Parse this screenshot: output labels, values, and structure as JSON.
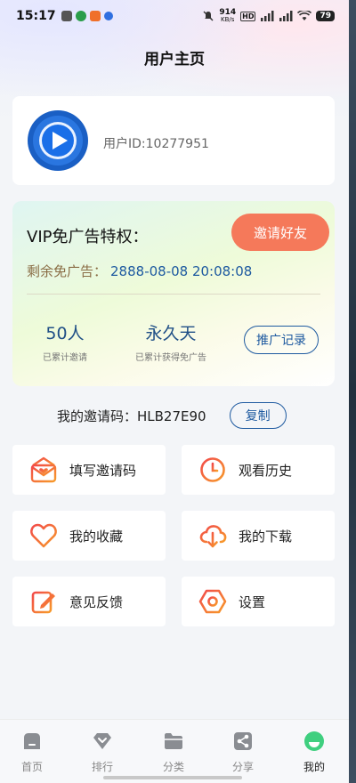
{
  "status_bar": {
    "time": "15:17",
    "speed_value": "914",
    "speed_unit": "KB/s",
    "battery": "79"
  },
  "header": {
    "title": "用户主页"
  },
  "user": {
    "id_text": "用户ID:10277951"
  },
  "vip": {
    "title": "VIP免广告特权：",
    "invite_button": "邀请好友",
    "remaining_label": "剩余免广告：",
    "remaining_value": "2888-08-08 20:08:08",
    "stats": [
      {
        "value": "50人",
        "label": "已累计邀请"
      },
      {
        "value": "永久天",
        "label": "已累计获得免广告"
      }
    ],
    "promo_button": "推广记录"
  },
  "invite_code": {
    "text": "我的邀请码：HLB27E90",
    "copy_button": "复制"
  },
  "menu": [
    {
      "label": "填写邀请码",
      "icon": "mail-heart-icon"
    },
    {
      "label": "观看历史",
      "icon": "clock-icon"
    },
    {
      "label": "我的收藏",
      "icon": "heart-icon"
    },
    {
      "label": "我的下载",
      "icon": "cloud-download-icon"
    },
    {
      "label": "意见反馈",
      "icon": "edit-icon"
    },
    {
      "label": "设置",
      "icon": "hexagon-settings-icon"
    }
  ],
  "tabbar": [
    {
      "label": "首页",
      "icon": "home-icon"
    },
    {
      "label": "排行",
      "icon": "ranking-icon"
    },
    {
      "label": "分类",
      "icon": "folder-icon"
    },
    {
      "label": "分享",
      "icon": "share-icon"
    },
    {
      "label": "我的",
      "icon": "profile-icon",
      "active": true
    }
  ],
  "colors": {
    "accent_blue": "#1e5aa0",
    "invite_orange": "#f5795a",
    "icon_gradient_start": "#f24a4a",
    "icon_gradient_end": "#f79a2a",
    "tab_active": "#3fcf7f"
  }
}
